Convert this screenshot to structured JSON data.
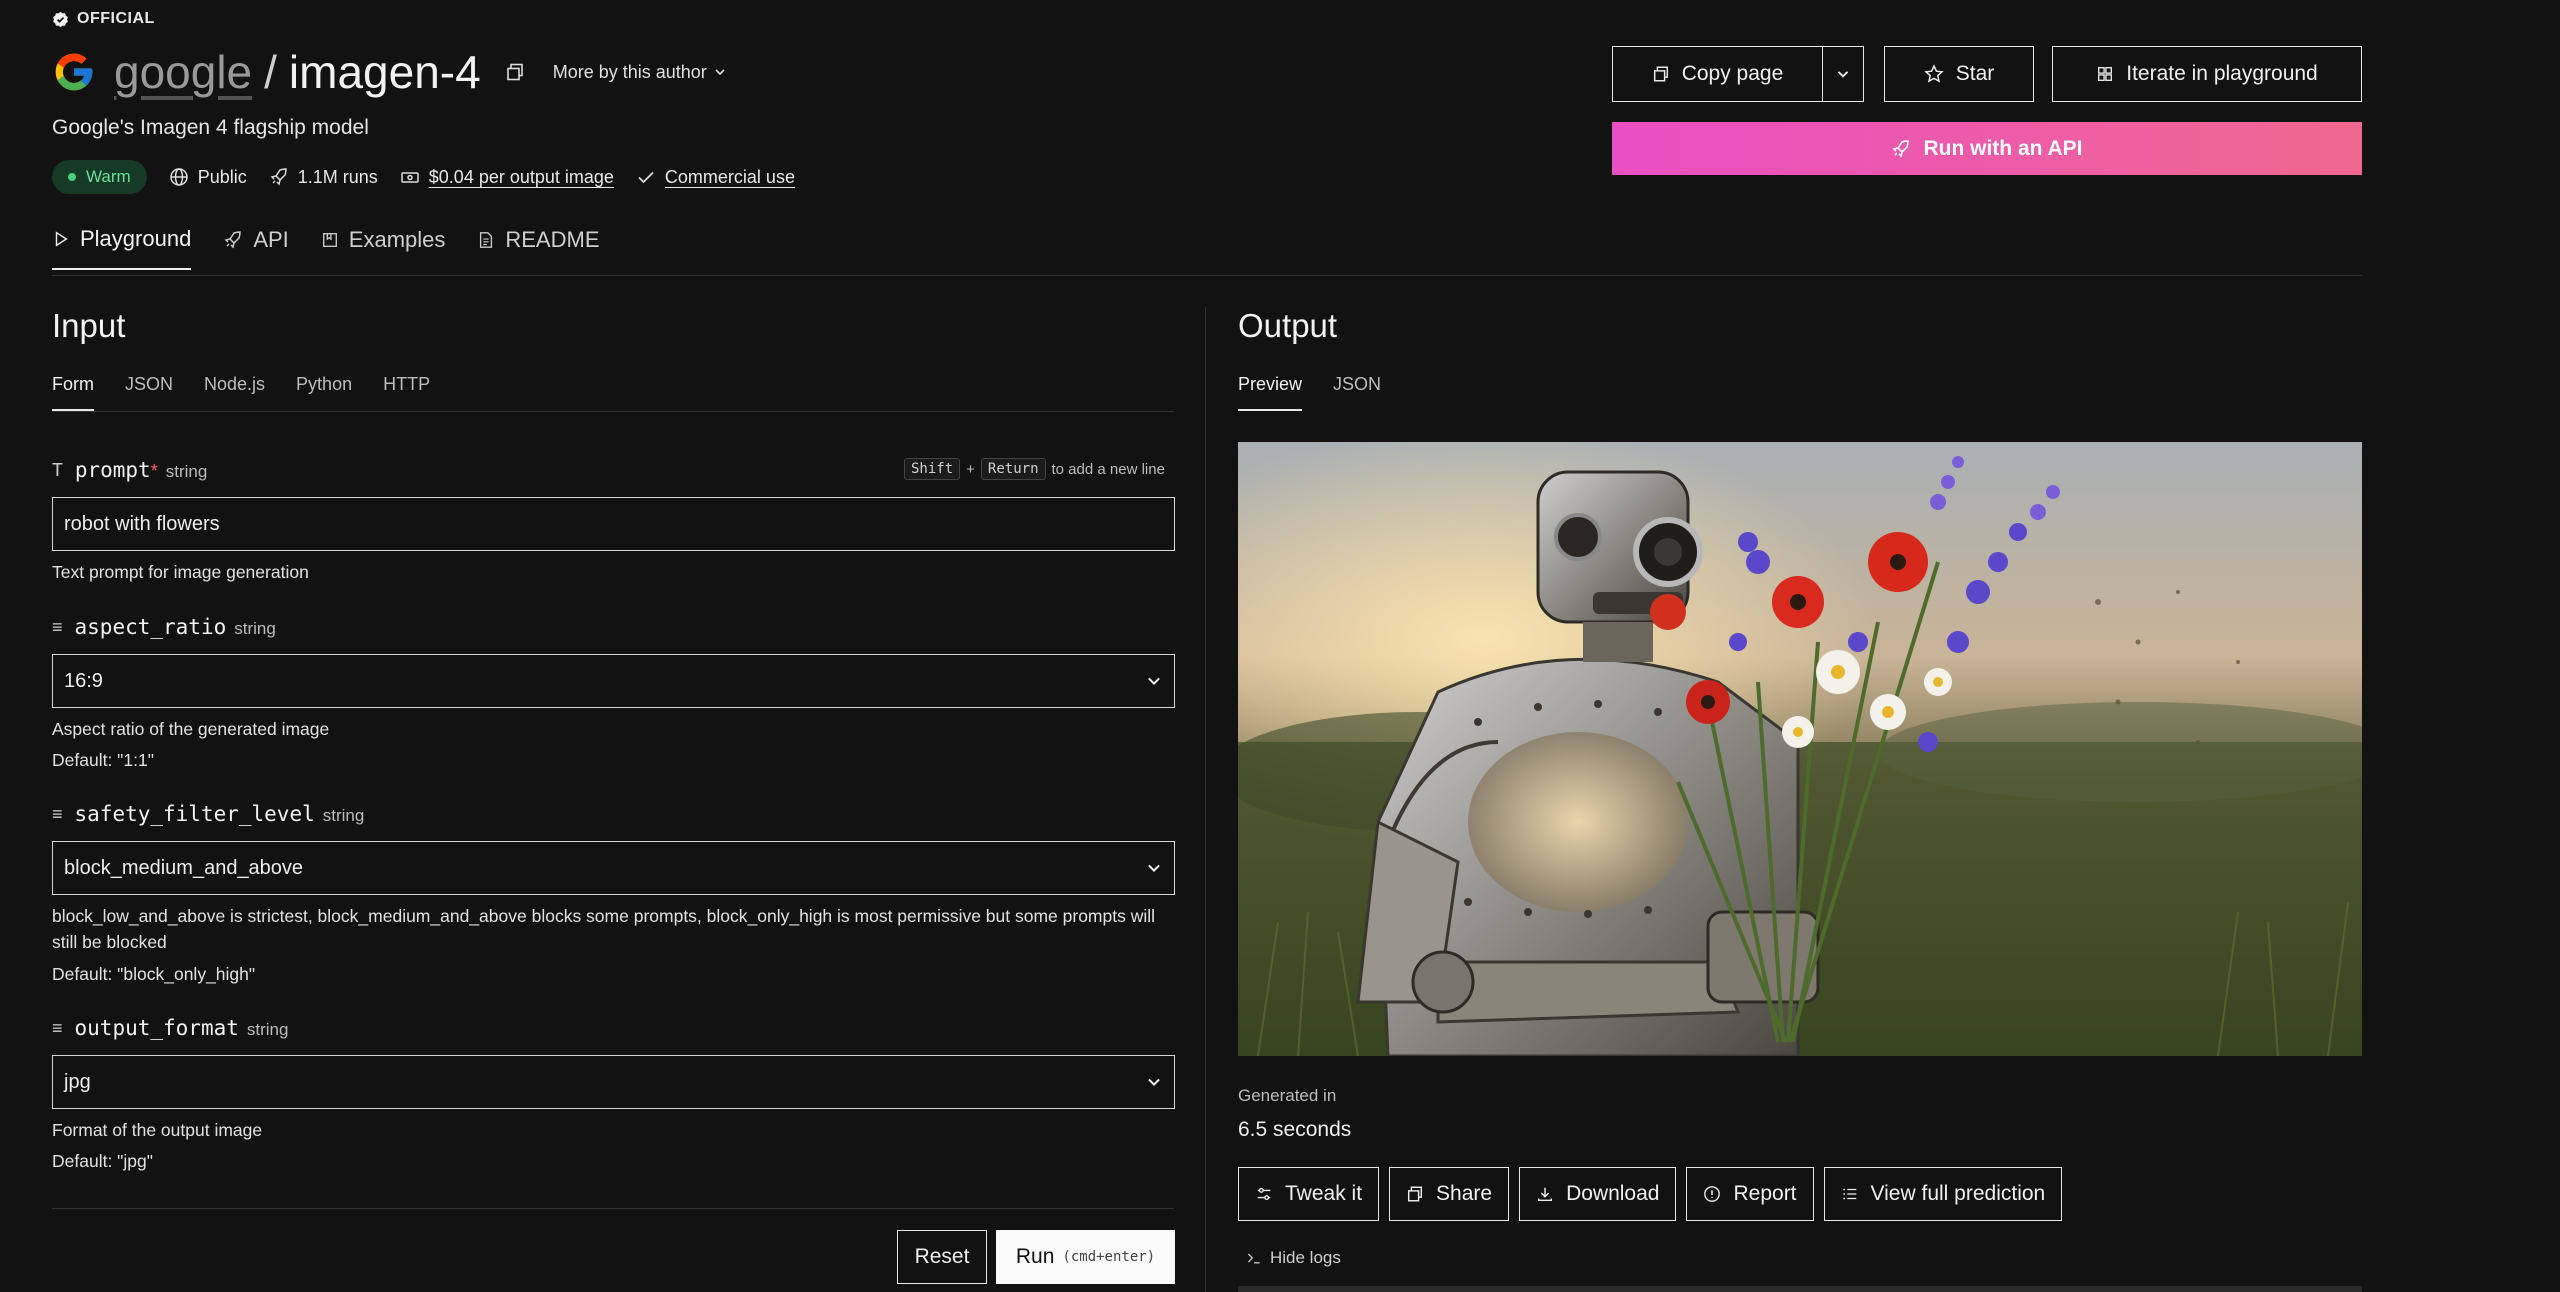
{
  "badge": "OFFICIAL",
  "model": {
    "owner": "google",
    "name": "imagen-4",
    "more_by_author": "More by this author",
    "description": "Google's Imagen 4 flagship model",
    "status": "Warm",
    "visibility": "Public",
    "runs": "1.1M runs",
    "price": "$0.04 per output image",
    "license": "Commercial use"
  },
  "header_buttons": {
    "copy_page": "Copy page",
    "star": "Star",
    "iterate": "Iterate in playground",
    "run_api": "Run with an API"
  },
  "tabs": [
    "Playground",
    "API",
    "Examples",
    "README"
  ],
  "input": {
    "heading": "Input",
    "subtabs": [
      "Form",
      "JSON",
      "Node.js",
      "Python",
      "HTTP"
    ],
    "newline_hint": {
      "key1": "Shift",
      "plus": "+",
      "key2": "Return",
      "text": "to add a new line"
    },
    "fields": {
      "prompt": {
        "name": "prompt",
        "required_mark": "*",
        "type": "string",
        "value": "robot with flowers",
        "help": "Text prompt for image generation"
      },
      "aspect_ratio": {
        "name": "aspect_ratio",
        "type": "string",
        "value": "16:9",
        "help": "Aspect ratio of the generated image",
        "default": "Default: \"1:1\""
      },
      "safety_filter_level": {
        "name": "safety_filter_level",
        "type": "string",
        "value": "block_medium_and_above",
        "help": "block_low_and_above is strictest, block_medium_and_above blocks some prompts, block_only_high is most permissive but some prompts will still be blocked",
        "default": "Default: \"block_only_high\""
      },
      "output_format": {
        "name": "output_format",
        "type": "string",
        "value": "jpg",
        "help": "Format of the output image",
        "default": "Default: \"jpg\""
      }
    },
    "reset": "Reset",
    "run": "Run",
    "run_shortcut": "(cmd+enter)"
  },
  "output": {
    "heading": "Output",
    "subtabs": [
      "Preview",
      "JSON"
    ],
    "generated_label": "Generated in",
    "generated_value": "6.5 seconds",
    "actions": [
      "Tweak it",
      "Share",
      "Download",
      "Report",
      "View full prediction"
    ],
    "hide_logs": "Hide logs"
  },
  "colors": {
    "accent_gradient_start": "#e94fc4",
    "accent_gradient_end": "#f0688e",
    "warm_green": "#4ad07f",
    "required": "#ff5c6c"
  }
}
